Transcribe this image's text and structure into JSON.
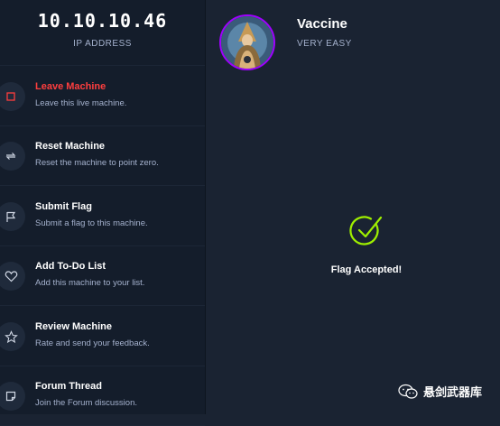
{
  "ip": {
    "value": "10.10.10.46",
    "label": "IP ADDRESS"
  },
  "menu": [
    {
      "title": "Leave Machine",
      "desc": "Leave this live machine.",
      "icon": "square-stop-icon"
    },
    {
      "title": "Reset Machine",
      "desc": "Reset the machine to point zero.",
      "icon": "refresh-icon"
    },
    {
      "title": "Submit Flag",
      "desc": "Submit a flag to this machine.",
      "icon": "flag-icon"
    },
    {
      "title": "Add To-Do List",
      "desc": "Add this machine to your list.",
      "icon": "heart-icon"
    },
    {
      "title": "Review Machine",
      "desc": "Rate and send your feedback.",
      "icon": "star-icon"
    },
    {
      "title": "Forum Thread",
      "desc": "Join the Forum discussion.",
      "icon": "note-icon"
    }
  ],
  "machine": {
    "name": "Vaccine",
    "difficulty": "VERY EASY"
  },
  "status": {
    "message": "Flag Accepted!"
  },
  "watermark": {
    "text": "悬剑武器库"
  },
  "colors": {
    "accent_red": "#ff3e3e",
    "accent_green": "#9fef00",
    "avatar_ring": "#9f00ff"
  }
}
